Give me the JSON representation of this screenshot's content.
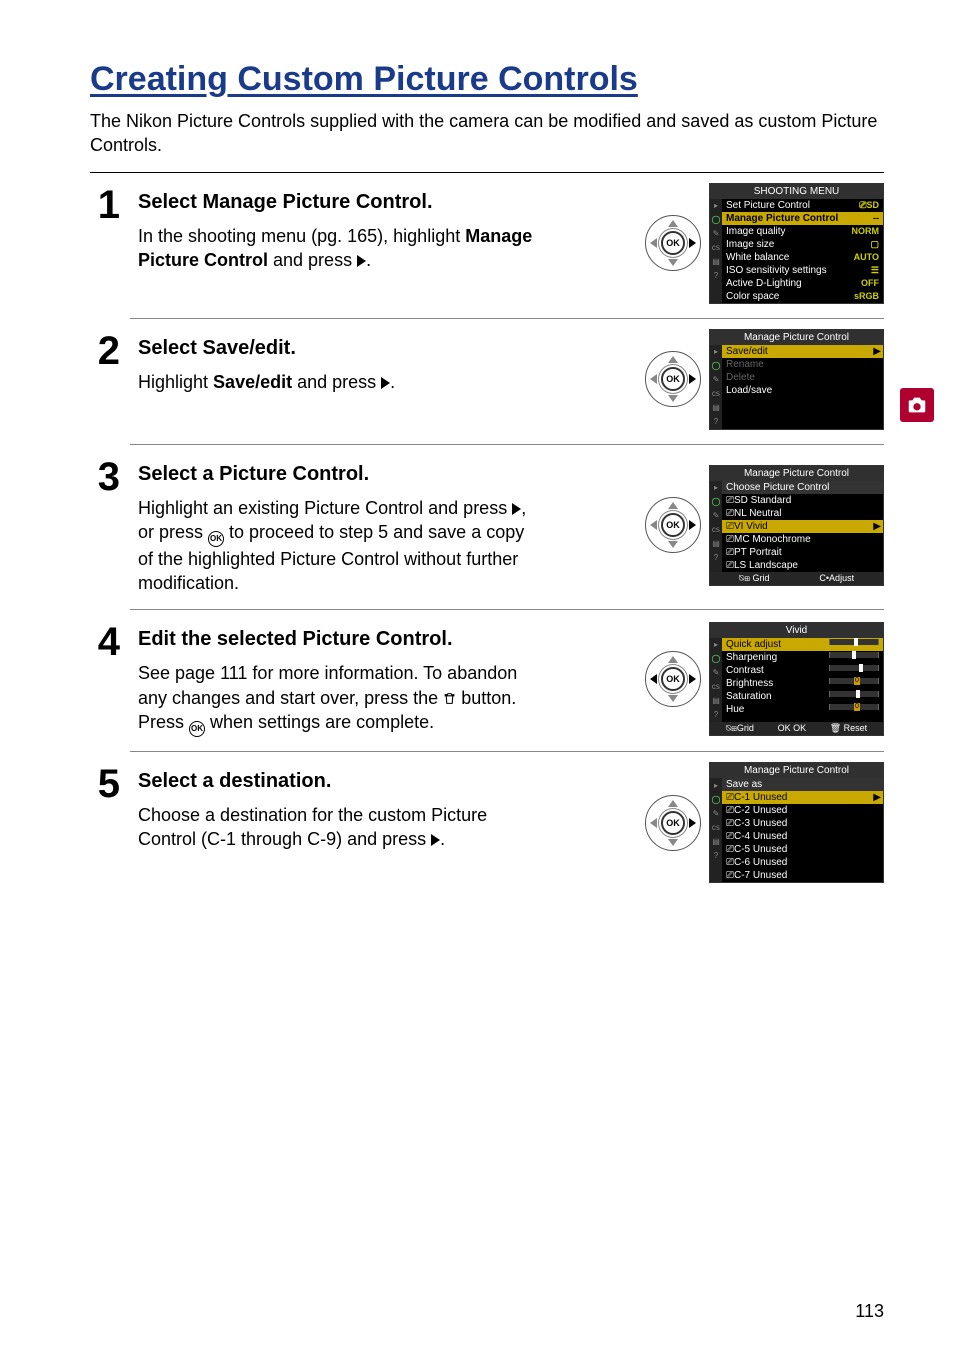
{
  "title": "Creating Custom Picture Controls",
  "intro": "The Nikon Picture Controls supplied with the camera can be modified and saved as custom Picture Controls.",
  "page_number": "113",
  "side_icon": "camera-icon",
  "steps": [
    {
      "num": "1",
      "head_pre": "Select ",
      "head_bold": "Manage Picture Control",
      "head_post": ".",
      "text_pre": "In the shooting menu (pg. 165), highlight ",
      "text_bold": "Manage Picture Control",
      "text_post": " and press ",
      "pad_right_hl": true,
      "lcd": {
        "title": "SHOOTING MENU",
        "rows": [
          {
            "label": "Set Picture Control",
            "val": "⎚SD"
          },
          {
            "label": "Manage Picture Control",
            "val": "--",
            "hl": true
          },
          {
            "label": "Image quality",
            "val": "NORM"
          },
          {
            "label": "Image size",
            "val": "▢"
          },
          {
            "label": "White balance",
            "val": "AUTO"
          },
          {
            "label": "ISO sensitivity settings",
            "val": "☰"
          },
          {
            "label": "Active D-Lighting",
            "val": "OFF"
          },
          {
            "label": "Color space",
            "val": "sRGB"
          }
        ]
      }
    },
    {
      "num": "2",
      "head_pre": "Select ",
      "head_bold": "Save/edit",
      "head_post": ".",
      "text_pre": "Highlight ",
      "text_bold": "Save/edit",
      "text_post": " and press ",
      "pad_right_hl": true,
      "lcd": {
        "title": "Manage Picture Control",
        "rows": [
          {
            "label": "Save/edit",
            "sel": true
          },
          {
            "label": "Rename",
            "dim": true
          },
          {
            "label": "Delete",
            "dim": true
          },
          {
            "label": "Load/save"
          }
        ]
      }
    },
    {
      "num": "3",
      "head_pre": "Select a Picture Control.",
      "head_bold": "",
      "head_post": "",
      "text_combined": "Highlight an existing Picture Control and press {RIGHT}, or press {OK} to proceed to step 5 and save a copy of the highlighted Picture Control without further modification.",
      "pad_right_hl": true,
      "lcd": {
        "title": "Manage Picture Control",
        "subtitle": "Choose Picture Control",
        "rows": [
          {
            "label": "⎚SD Standard"
          },
          {
            "label": "⎚NL Neutral"
          },
          {
            "label": "⎚VI Vivid",
            "sel": true
          },
          {
            "label": "⎚MC Monochrome"
          },
          {
            "label": "⎚PT Portrait"
          },
          {
            "label": "⎚LS Landscape"
          }
        ],
        "footer": [
          "⍉⊞ Grid",
          "C•Adjust"
        ]
      }
    },
    {
      "num": "4",
      "head_pre": "Edit the selected Picture Control.",
      "head_bold": "",
      "head_post": "",
      "text_combined": "See page 111 for more information.  To abandon any changes and start over, press the {TRASH} button. Press {OK} when settings are complete.",
      "pad_no_hl": true,
      "lcd": {
        "title": "Vivid",
        "sliders": [
          {
            "label": "Quick adjust",
            "pos": 50,
            "seg": true
          },
          {
            "label": "Sharpening",
            "pos": 45
          },
          {
            "label": "Contrast",
            "pos": 60
          },
          {
            "label": "Brightness",
            "zero": 50
          },
          {
            "label": "Saturation",
            "pos": 55
          },
          {
            "label": "Hue",
            "zero": 50
          }
        ],
        "footer": [
          "⍉⊞Grid",
          "OK OK",
          "🗑 Reset"
        ]
      }
    },
    {
      "num": "5",
      "head_pre": "Select a destination.",
      "head_bold": "",
      "head_post": "",
      "text_combined": "Choose a destination for the custom Picture Control (C-1 through C-9) and press {RIGHT}.",
      "pad_right_hl": true,
      "lcd": {
        "title": "Manage Picture Control",
        "subtitle": "Save as",
        "rows": [
          {
            "label": "⎚C-1 Unused",
            "sel": true
          },
          {
            "label": "⎚C-2 Unused"
          },
          {
            "label": "⎚C-3 Unused"
          },
          {
            "label": "⎚C-4 Unused"
          },
          {
            "label": "⎚C-5 Unused"
          },
          {
            "label": "⎚C-6 Unused"
          },
          {
            "label": "⎚C-7 Unused"
          }
        ]
      }
    }
  ]
}
